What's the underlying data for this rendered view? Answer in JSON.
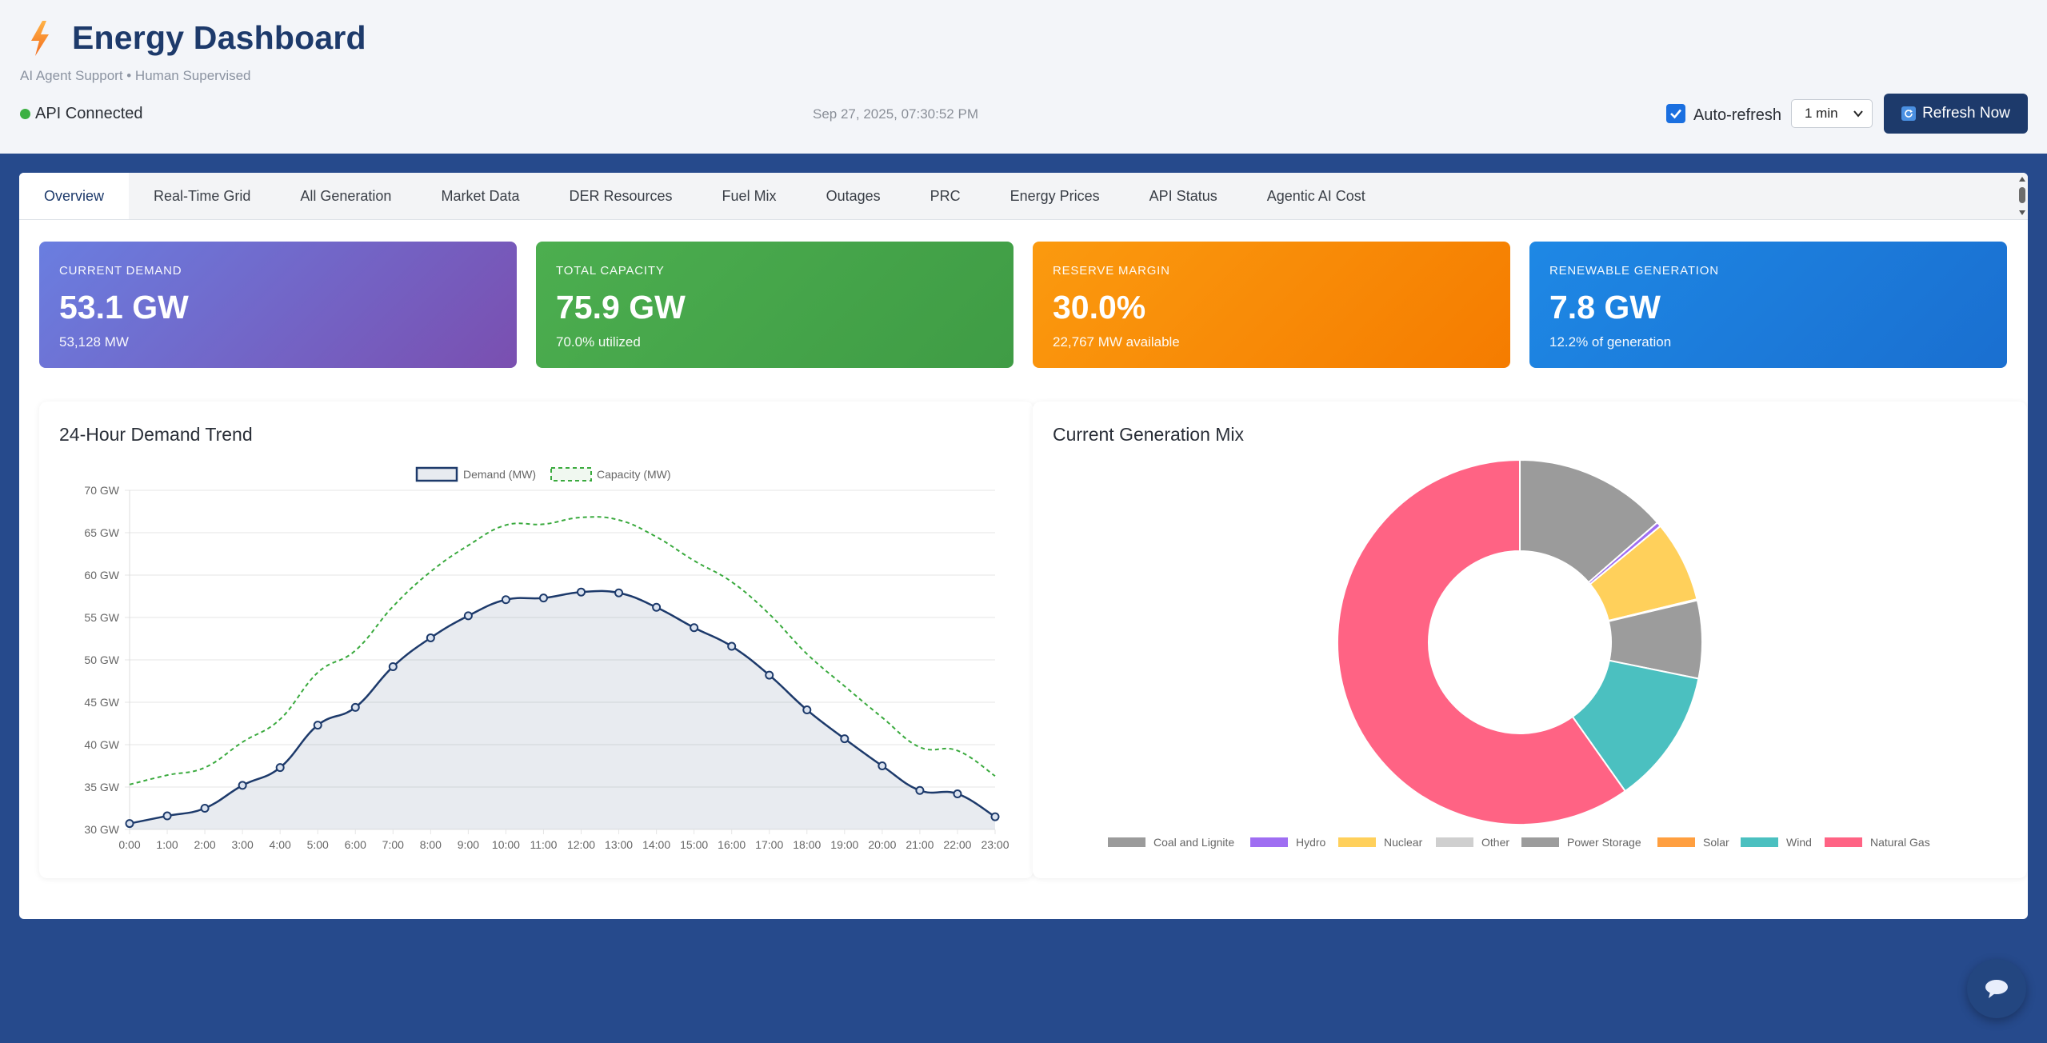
{
  "header": {
    "title": "Energy Dashboard",
    "subtitle": "AI Agent Support • Human Supervised",
    "api_status": "API Connected",
    "timestamp": "Sep 27, 2025, 07:30:52 PM",
    "auto_refresh_label": "Auto-refresh",
    "auto_refresh_checked": true,
    "interval_value": "1 min",
    "refresh_button": "Refresh Now",
    "icons": [
      "lightning-bolt-icon",
      "refresh-icon",
      "chevron-down-icon",
      "checkbox-check-icon"
    ]
  },
  "tabs": [
    {
      "label": "Overview",
      "active": true
    },
    {
      "label": "Real-Time Grid"
    },
    {
      "label": "All Generation"
    },
    {
      "label": "Market Data"
    },
    {
      "label": "DER Resources"
    },
    {
      "label": "Fuel Mix"
    },
    {
      "label": "Outages"
    },
    {
      "label": "PRC"
    },
    {
      "label": "Energy Prices"
    },
    {
      "label": "API Status"
    },
    {
      "label": "Agentic AI Cost"
    }
  ],
  "metrics": [
    {
      "label": "Current Demand",
      "value": "53.1 GW",
      "sub": "53,128 MW",
      "gradient": [
        "#6a7ee0",
        "#7a4fb0"
      ]
    },
    {
      "label": "Total Capacity",
      "value": "75.9 GW",
      "sub": "70.0% utilized",
      "gradient": [
        "#4cae4f",
        "#3f9c45"
      ]
    },
    {
      "label": "Reserve Margin",
      "value": "30.0%",
      "sub": "22,767 MW available",
      "gradient": [
        "#fb9a0f",
        "#f57c00"
      ]
    },
    {
      "label": "Renewable Generation",
      "value": "7.8 GW",
      "sub": "12.2% of generation",
      "gradient": [
        "#1e88e5",
        "#1a6fd0"
      ]
    }
  ],
  "demand_chart_title": "24-Hour Demand Trend",
  "mix_chart_title": "Current Generation Mix",
  "chart_data": [
    {
      "type": "line",
      "title": "24-Hour Demand Trend",
      "x": [
        "0:00",
        "1:00",
        "2:00",
        "3:00",
        "4:00",
        "5:00",
        "6:00",
        "7:00",
        "8:00",
        "9:00",
        "10:00",
        "11:00",
        "12:00",
        "13:00",
        "14:00",
        "15:00",
        "16:00",
        "17:00",
        "18:00",
        "19:00",
        "20:00",
        "21:00",
        "22:00",
        "23:00"
      ],
      "y_ticks": [
        "30 GW",
        "35 GW",
        "40 GW",
        "45 GW",
        "50 GW",
        "55 GW",
        "60 GW",
        "65 GW",
        "70 GW"
      ],
      "ylim": [
        30,
        70
      ],
      "legend_position": "top-center",
      "grid": true,
      "series": [
        {
          "name": "Demand (MW)",
          "color": "#1d3a6b",
          "fill": "rgba(29,58,107,0.1)",
          "style": "solid",
          "markers": true,
          "values": [
            30.7,
            31.6,
            32.5,
            35.2,
            37.3,
            42.3,
            44.4,
            49.2,
            52.6,
            55.2,
            57.1,
            57.3,
            58.0,
            57.9,
            56.2,
            53.8,
            51.6,
            48.2,
            44.1,
            40.7,
            37.5,
            34.6,
            34.2,
            31.5
          ]
        },
        {
          "name": "Capacity (MW)",
          "color": "#3aaa3e",
          "style": "dashed",
          "markers": false,
          "values": [
            35.3,
            36.4,
            37.3,
            40.3,
            43.0,
            48.5,
            51.1,
            56.3,
            60.4,
            63.5,
            65.9,
            66.0,
            66.8,
            66.5,
            64.5,
            61.7,
            59.2,
            55.4,
            50.7,
            46.9,
            43.2,
            39.7,
            39.3,
            36.3
          ]
        }
      ]
    },
    {
      "type": "pie",
      "title": "Current Generation Mix",
      "donut": true,
      "legend_position": "bottom",
      "labels": [
        "Coal and Lignite",
        "Hydro",
        "Nuclear",
        "Other",
        "Power Storage",
        "Solar",
        "Wind",
        "Natural Gas"
      ],
      "colors": [
        "#9b9b9b",
        "#9f6ef2",
        "#ffd05b",
        "#cfcfcf",
        "#9c9c9c",
        "#ff9f40",
        "#4bc0c0",
        "#ff6384"
      ],
      "values": [
        13.6,
        0.4,
        7.2,
        0.1,
        6.9,
        0.0,
        12.0,
        59.8
      ]
    }
  ]
}
